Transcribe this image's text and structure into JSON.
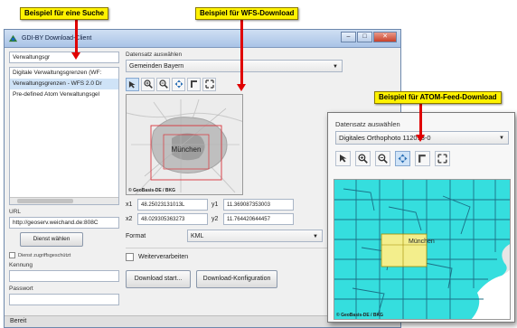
{
  "callouts": {
    "search": "Beispiel für eine Suche",
    "wfs": "Beispiel für WFS-Download",
    "atom": "Beispiel für ATOM-Feed-Download"
  },
  "window": {
    "title": "GDI-BY Download-Client",
    "controls": {
      "minimize": "–",
      "maximize": "□",
      "close": "✕"
    }
  },
  "search": {
    "value": "Verwaltungsgr"
  },
  "results": [
    {
      "label": "Digitale Verwaltungsgrenzen (WF:",
      "selected": false
    },
    {
      "label": "Verwaltungsgrenzen - WFS 2.0 Dr",
      "selected": true
    },
    {
      "label": "Pre-defined Atom Verwaltungsgel",
      "selected": false
    }
  ],
  "url": {
    "label": "URL",
    "value": "http://geoserv.weichand.de:808C"
  },
  "select_service_button": "Dienst wählen",
  "protected_checkbox": "Dienst zugriffsgeschützt",
  "login": {
    "user_label": "Kennung",
    "password_label": "Passwort"
  },
  "dataset": {
    "label": "Datensatz auswählen",
    "value": "Gemeinden Bayern"
  },
  "map": {
    "city_label": "München",
    "attribution": "© GeoBasis-DE / BKG"
  },
  "coords": {
    "x1_label": "x1",
    "x1": "48.25023131013L",
    "y1_label": "y1",
    "y1": "11.369087353003",
    "x2_label": "x2",
    "x2": "48.029305363273",
    "y2_label": "y2",
    "y2": "11.764420644457"
  },
  "format": {
    "label": "Format",
    "value": "KML"
  },
  "further_processing": "Weiterverarbeiten",
  "buttons": {
    "start": "Download start...",
    "config": "Download-Konfiguration"
  },
  "status": "Bereit",
  "atom_window": {
    "label": "Datensatz auswählen",
    "value": "Digitales Orthophoto 112013-0",
    "city_label": "München",
    "attribution": "© GeoBasis-DE / BKG"
  },
  "icons": {
    "toolbar": [
      "select-arrow-icon",
      "zoom-in-icon",
      "zoom-out-icon",
      "pan-icon",
      "selection-tool-icon",
      "extent-icon"
    ]
  },
  "colors": {
    "callout_bg": "#fff200",
    "arrow": "#e00000",
    "tile_fill": "#35dede",
    "tile_selected": "#f3ee8c",
    "bbox": "#d9343b"
  }
}
